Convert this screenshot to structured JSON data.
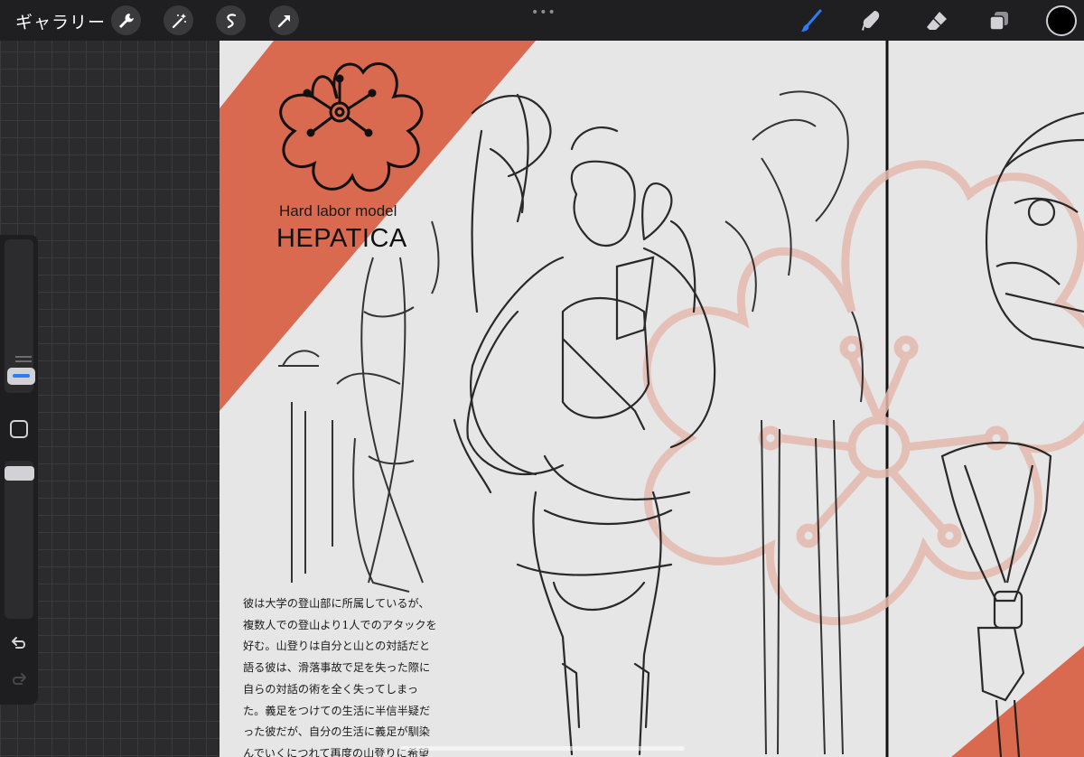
{
  "topbar": {
    "gallery_label": "ギャラリー",
    "left_tools": [
      "wrench-icon",
      "magic-wand-icon",
      "selection-icon",
      "transform-arrow-icon"
    ],
    "center_menu_label": "•••",
    "right_tools": [
      "brush-icon",
      "smudge-icon",
      "eraser-icon",
      "layers-icon"
    ],
    "active_tool": "brush-icon",
    "current_color": "#000000",
    "accent_color": "#2f7bf6"
  },
  "sidebar": {
    "brush_size_level": 0.85,
    "opacity_level": 0.97,
    "undo_icon": "undo-icon",
    "redo_icon": "redo-icon"
  },
  "artwork": {
    "subtitle": "Hard labor model",
    "title": "HEPATICA",
    "body": "彼は大学の登山部に所属しているが、\n複数人での登山より1人でのアタックを\n好む。山登りは自分と山との対話だと\n語る彼は、滑落事故で足を失った際に\n自らの対話の術を全く失ってしまっ\nた。義足をつけての生活に半信半疑だ\nった彼だが、自分の生活に義足が馴染\nんでいくにつれて再度の山登りに希望\nを見出すようになった。",
    "accent_color": "#d9694f",
    "watermark_color": "#e4b9ae"
  }
}
